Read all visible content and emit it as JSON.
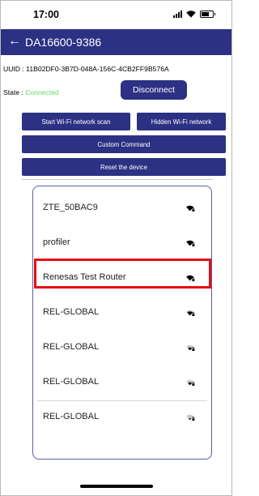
{
  "status_bar": {
    "time": "17:00",
    "icons": [
      "cellular-signal-icon",
      "wifi-icon",
      "battery-icon"
    ]
  },
  "app_bar": {
    "back_icon": "←",
    "title": "DA16600-9386",
    "background_color": "#2c3183"
  },
  "device": {
    "uuid_label": "UUID : ",
    "uuid_value": "11B02DF0-3B7D-048A-156C-4CB2FF9B576A",
    "state_label": "State : ",
    "state_value": "Connected",
    "state_color": "#6ad86a"
  },
  "buttons": {
    "disconnect": "Disconnect",
    "scan": "Start Wi-Fi network scan",
    "hidden": "Hidden Wi-Fi network",
    "custom": "Custom Command",
    "reset": "Reset the device"
  },
  "wifi_networks": [
    {
      "ssid": "ZTE_50BAC9",
      "signal_strength": 4,
      "secured": true
    },
    {
      "ssid": "profiler",
      "signal_strength": 4,
      "secured": true
    },
    {
      "ssid": "Renesas Test Router",
      "signal_strength": 4,
      "secured": true,
      "highlighted": true
    },
    {
      "ssid": "REL-GLOBAL",
      "signal_strength": 3,
      "secured": true
    },
    {
      "ssid": "REL-GLOBAL",
      "signal_strength": 2,
      "secured": true
    },
    {
      "ssid": "REL-GLOBAL",
      "signal_strength": 2,
      "secured": true
    },
    {
      "ssid": "REL-GLOBAL",
      "signal_strength": 1,
      "secured": true
    }
  ],
  "highlight_color": "#e30d16"
}
